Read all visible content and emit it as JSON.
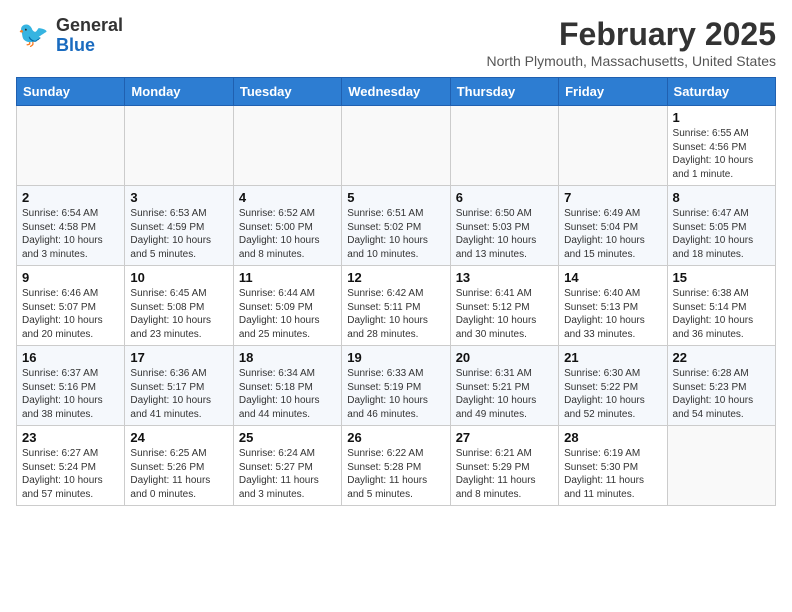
{
  "header": {
    "logo_line1": "General",
    "logo_line2": "Blue",
    "month": "February 2025",
    "location": "North Plymouth, Massachusetts, United States"
  },
  "weekdays": [
    "Sunday",
    "Monday",
    "Tuesday",
    "Wednesday",
    "Thursday",
    "Friday",
    "Saturday"
  ],
  "weeks": [
    [
      {
        "day": "",
        "info": ""
      },
      {
        "day": "",
        "info": ""
      },
      {
        "day": "",
        "info": ""
      },
      {
        "day": "",
        "info": ""
      },
      {
        "day": "",
        "info": ""
      },
      {
        "day": "",
        "info": ""
      },
      {
        "day": "1",
        "info": "Sunrise: 6:55 AM\nSunset: 4:56 PM\nDaylight: 10 hours\nand 1 minute."
      }
    ],
    [
      {
        "day": "2",
        "info": "Sunrise: 6:54 AM\nSunset: 4:58 PM\nDaylight: 10 hours\nand 3 minutes."
      },
      {
        "day": "3",
        "info": "Sunrise: 6:53 AM\nSunset: 4:59 PM\nDaylight: 10 hours\nand 5 minutes."
      },
      {
        "day": "4",
        "info": "Sunrise: 6:52 AM\nSunset: 5:00 PM\nDaylight: 10 hours\nand 8 minutes."
      },
      {
        "day": "5",
        "info": "Sunrise: 6:51 AM\nSunset: 5:02 PM\nDaylight: 10 hours\nand 10 minutes."
      },
      {
        "day": "6",
        "info": "Sunrise: 6:50 AM\nSunset: 5:03 PM\nDaylight: 10 hours\nand 13 minutes."
      },
      {
        "day": "7",
        "info": "Sunrise: 6:49 AM\nSunset: 5:04 PM\nDaylight: 10 hours\nand 15 minutes."
      },
      {
        "day": "8",
        "info": "Sunrise: 6:47 AM\nSunset: 5:05 PM\nDaylight: 10 hours\nand 18 minutes."
      }
    ],
    [
      {
        "day": "9",
        "info": "Sunrise: 6:46 AM\nSunset: 5:07 PM\nDaylight: 10 hours\nand 20 minutes."
      },
      {
        "day": "10",
        "info": "Sunrise: 6:45 AM\nSunset: 5:08 PM\nDaylight: 10 hours\nand 23 minutes."
      },
      {
        "day": "11",
        "info": "Sunrise: 6:44 AM\nSunset: 5:09 PM\nDaylight: 10 hours\nand 25 minutes."
      },
      {
        "day": "12",
        "info": "Sunrise: 6:42 AM\nSunset: 5:11 PM\nDaylight: 10 hours\nand 28 minutes."
      },
      {
        "day": "13",
        "info": "Sunrise: 6:41 AM\nSunset: 5:12 PM\nDaylight: 10 hours\nand 30 minutes."
      },
      {
        "day": "14",
        "info": "Sunrise: 6:40 AM\nSunset: 5:13 PM\nDaylight: 10 hours\nand 33 minutes."
      },
      {
        "day": "15",
        "info": "Sunrise: 6:38 AM\nSunset: 5:14 PM\nDaylight: 10 hours\nand 36 minutes."
      }
    ],
    [
      {
        "day": "16",
        "info": "Sunrise: 6:37 AM\nSunset: 5:16 PM\nDaylight: 10 hours\nand 38 minutes."
      },
      {
        "day": "17",
        "info": "Sunrise: 6:36 AM\nSunset: 5:17 PM\nDaylight: 10 hours\nand 41 minutes."
      },
      {
        "day": "18",
        "info": "Sunrise: 6:34 AM\nSunset: 5:18 PM\nDaylight: 10 hours\nand 44 minutes."
      },
      {
        "day": "19",
        "info": "Sunrise: 6:33 AM\nSunset: 5:19 PM\nDaylight: 10 hours\nand 46 minutes."
      },
      {
        "day": "20",
        "info": "Sunrise: 6:31 AM\nSunset: 5:21 PM\nDaylight: 10 hours\nand 49 minutes."
      },
      {
        "day": "21",
        "info": "Sunrise: 6:30 AM\nSunset: 5:22 PM\nDaylight: 10 hours\nand 52 minutes."
      },
      {
        "day": "22",
        "info": "Sunrise: 6:28 AM\nSunset: 5:23 PM\nDaylight: 10 hours\nand 54 minutes."
      }
    ],
    [
      {
        "day": "23",
        "info": "Sunrise: 6:27 AM\nSunset: 5:24 PM\nDaylight: 10 hours\nand 57 minutes."
      },
      {
        "day": "24",
        "info": "Sunrise: 6:25 AM\nSunset: 5:26 PM\nDaylight: 11 hours\nand 0 minutes."
      },
      {
        "day": "25",
        "info": "Sunrise: 6:24 AM\nSunset: 5:27 PM\nDaylight: 11 hours\nand 3 minutes."
      },
      {
        "day": "26",
        "info": "Sunrise: 6:22 AM\nSunset: 5:28 PM\nDaylight: 11 hours\nand 5 minutes."
      },
      {
        "day": "27",
        "info": "Sunrise: 6:21 AM\nSunset: 5:29 PM\nDaylight: 11 hours\nand 8 minutes."
      },
      {
        "day": "28",
        "info": "Sunrise: 6:19 AM\nSunset: 5:30 PM\nDaylight: 11 hours\nand 11 minutes."
      },
      {
        "day": "",
        "info": ""
      }
    ]
  ]
}
